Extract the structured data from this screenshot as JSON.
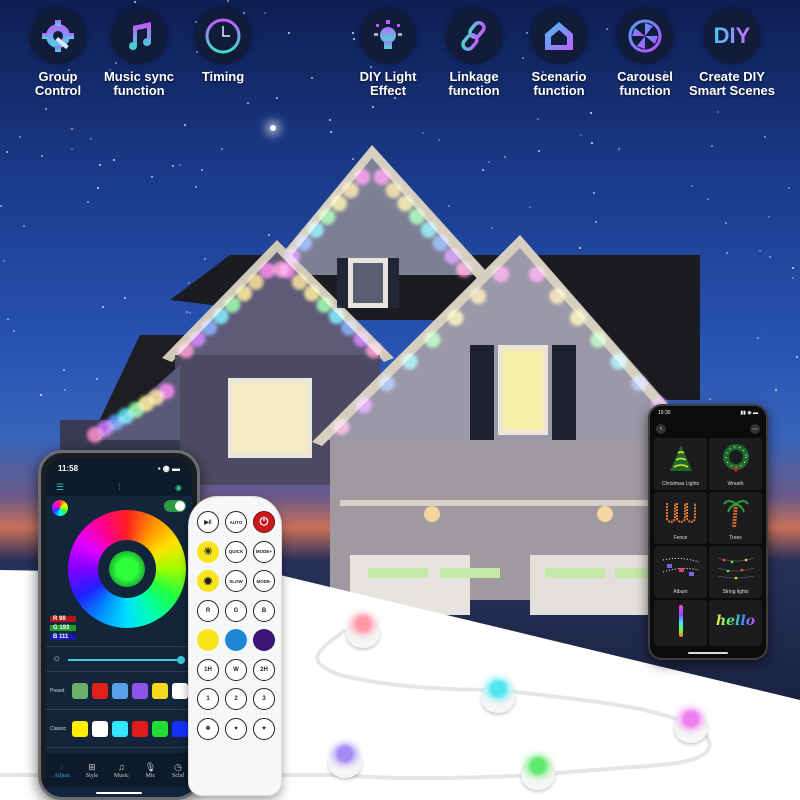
{
  "features": [
    {
      "icon": "gear-wrench-icon",
      "label_line1": "Group",
      "label_line2": "Control"
    },
    {
      "icon": "music-note-icon",
      "label_line1": "Music sync",
      "label_line2": "function"
    },
    {
      "icon": "clock-icon",
      "label_line1": "Timing",
      "label_line2": ""
    },
    {
      "icon": "light-bulb-icon",
      "label_line1": "DIY Light",
      "label_line2": "Effect"
    },
    {
      "icon": "link-icon",
      "label_line1": "Linkage",
      "label_line2": "function"
    },
    {
      "icon": "house-icon",
      "label_line1": "Scenario",
      "label_line2": "function"
    },
    {
      "icon": "carousel-icon",
      "label_line1": "Carousel",
      "label_line2": "function"
    },
    {
      "icon": "diy-text-icon",
      "icon_text": "DIY",
      "label_line1": "Create DIY",
      "label_line2": "Smart Scenes"
    }
  ],
  "left_phone": {
    "time": "11:58",
    "rgb": {
      "r_label": "R",
      "r": "98",
      "g_label": "G",
      "g": "193",
      "b_label": "B",
      "b": "111"
    },
    "preset_label": "Preset",
    "classic_label": "Classic",
    "preset_colors": [
      "#6aaf6a",
      "#e0201f",
      "#5aa0e8",
      "#8a55e8",
      "#f2d81e",
      "#ffffff"
    ],
    "classic_colors": [
      "#ffee00",
      "#ffffff",
      "#33e5ff",
      "#e01c1c",
      "#22dd33",
      "#1530ff"
    ],
    "tabs": [
      {
        "icon": "sliders-icon",
        "label": "Adjust",
        "active": true
      },
      {
        "icon": "grid-icon",
        "label": "Style",
        "active": false
      },
      {
        "icon": "music-icon",
        "label": "Music",
        "active": false
      },
      {
        "icon": "mic-icon",
        "label": "Mic",
        "active": false
      },
      {
        "icon": "schedule-icon",
        "label": "Schd",
        "active": false
      }
    ],
    "brightness": 1.0,
    "power_on": true
  },
  "remote": {
    "buttons": [
      {
        "name": "play-pause-button",
        "label": "▶‖",
        "style": "outline"
      },
      {
        "name": "auto-button",
        "label": "AUTO",
        "style": "outline"
      },
      {
        "name": "power-button",
        "label": "⏻",
        "style": "red"
      },
      {
        "name": "brightness-up-button",
        "label": "☀",
        "style": "yellow"
      },
      {
        "name": "quick-button",
        "label": "QUICK",
        "style": "outline"
      },
      {
        "name": "mode-plus-button",
        "label": "MODE+",
        "style": "outline"
      },
      {
        "name": "brightness-down-button",
        "label": "✹",
        "style": "yellow"
      },
      {
        "name": "slow-button",
        "label": "SLOW",
        "style": "outline"
      },
      {
        "name": "mode-minus-button",
        "label": "MODE-",
        "style": "outline"
      },
      {
        "name": "red-button",
        "label": "R",
        "style": "outline"
      },
      {
        "name": "green-button",
        "label": "G",
        "style": "outline"
      },
      {
        "name": "blue-button",
        "label": "B",
        "style": "outline"
      },
      {
        "name": "yellow-color-button",
        "label": "",
        "style": "color",
        "color": "#f8e61c"
      },
      {
        "name": "sky-blue-color-button",
        "label": "",
        "style": "color",
        "color": "#1d86d6"
      },
      {
        "name": "purple-color-button",
        "label": "",
        "style": "color",
        "color": "#3c1478"
      },
      {
        "name": "timer-1h-button",
        "label": "1H",
        "style": "outline"
      },
      {
        "name": "white-button",
        "label": "W",
        "style": "outline"
      },
      {
        "name": "timer-2h-button",
        "label": "2H",
        "style": "outline"
      },
      {
        "name": "music-mode-1-button",
        "label": "1",
        "style": "outline"
      },
      {
        "name": "music-mode-2-button",
        "label": "2",
        "style": "outline"
      },
      {
        "name": "music-mode-3-button",
        "label": "3",
        "style": "outline"
      },
      {
        "name": "snowflake-button",
        "label": "❄",
        "style": "outline"
      },
      {
        "name": "hearts-button",
        "label": "♥",
        "style": "outline"
      },
      {
        "name": "stars-button",
        "label": "✦",
        "style": "outline"
      }
    ]
  },
  "right_phone": {
    "time": "19:30",
    "tiles": [
      {
        "label": "Christmas Lights",
        "art": "christmas-tree-icon"
      },
      {
        "label": "Wreath",
        "art": "wreath-icon"
      },
      {
        "label": "Fence",
        "art": "fence-icon"
      },
      {
        "label": "Trees",
        "art": "palm-tree-icon"
      },
      {
        "label": "Album",
        "art": "album-icon"
      },
      {
        "label": "String lights",
        "art": "string-lights-icon"
      },
      {
        "label": "",
        "art": "light-bar-icon"
      },
      {
        "label": "",
        "art": "hello-text-icon",
        "art_text": "hello"
      }
    ]
  },
  "pixels": [
    {
      "color": "#ff9aa8"
    },
    {
      "color": "#4fe6f0"
    },
    {
      "color": "#f07ef0"
    },
    {
      "color": "#a58af5"
    },
    {
      "color": "#5fe86a"
    }
  ]
}
